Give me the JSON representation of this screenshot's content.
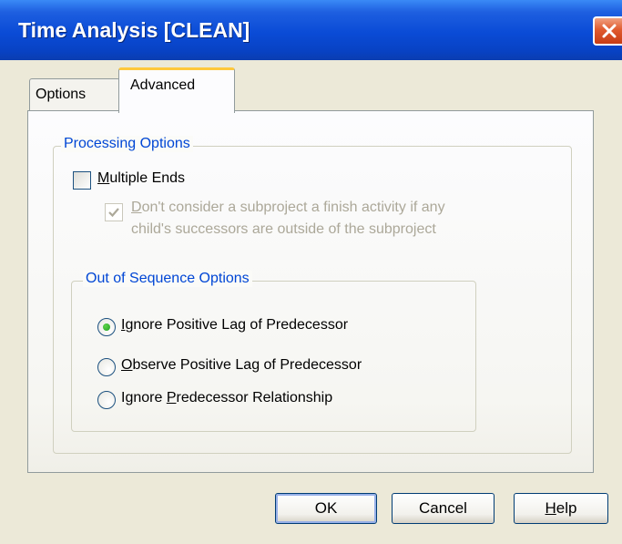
{
  "window": {
    "title": "Time Analysis [CLEAN]"
  },
  "tabs": [
    {
      "label": "Options",
      "selected": false
    },
    {
      "label": "Advanced",
      "selected": true
    }
  ],
  "processing_options": {
    "legend": "Processing Options",
    "multiple_ends": {
      "label_accel": "M",
      "label_rest": "ultiple Ends",
      "checked": false
    },
    "dont_consider": {
      "label_accel": "D",
      "label_line1_rest": "on't consider a subproject a finish activity if any",
      "label_line2": "child's successors are outside of the subproject",
      "checked": true,
      "disabled": true
    }
  },
  "out_of_sequence": {
    "legend": "Out of Sequence Options",
    "options": [
      {
        "accel": "I",
        "rest": "gnore Positive Lag of Predecessor",
        "selected": true
      },
      {
        "accel": "O",
        "rest": "bserve Positive Lag of Predecessor",
        "selected": false
      },
      {
        "pre": "Ignore ",
        "accel": "P",
        "rest": "redecessor Relationship",
        "selected": false
      }
    ]
  },
  "buttons": {
    "ok": "OK",
    "cancel": "Cancel",
    "help_accel": "H",
    "help_rest": "elp"
  }
}
